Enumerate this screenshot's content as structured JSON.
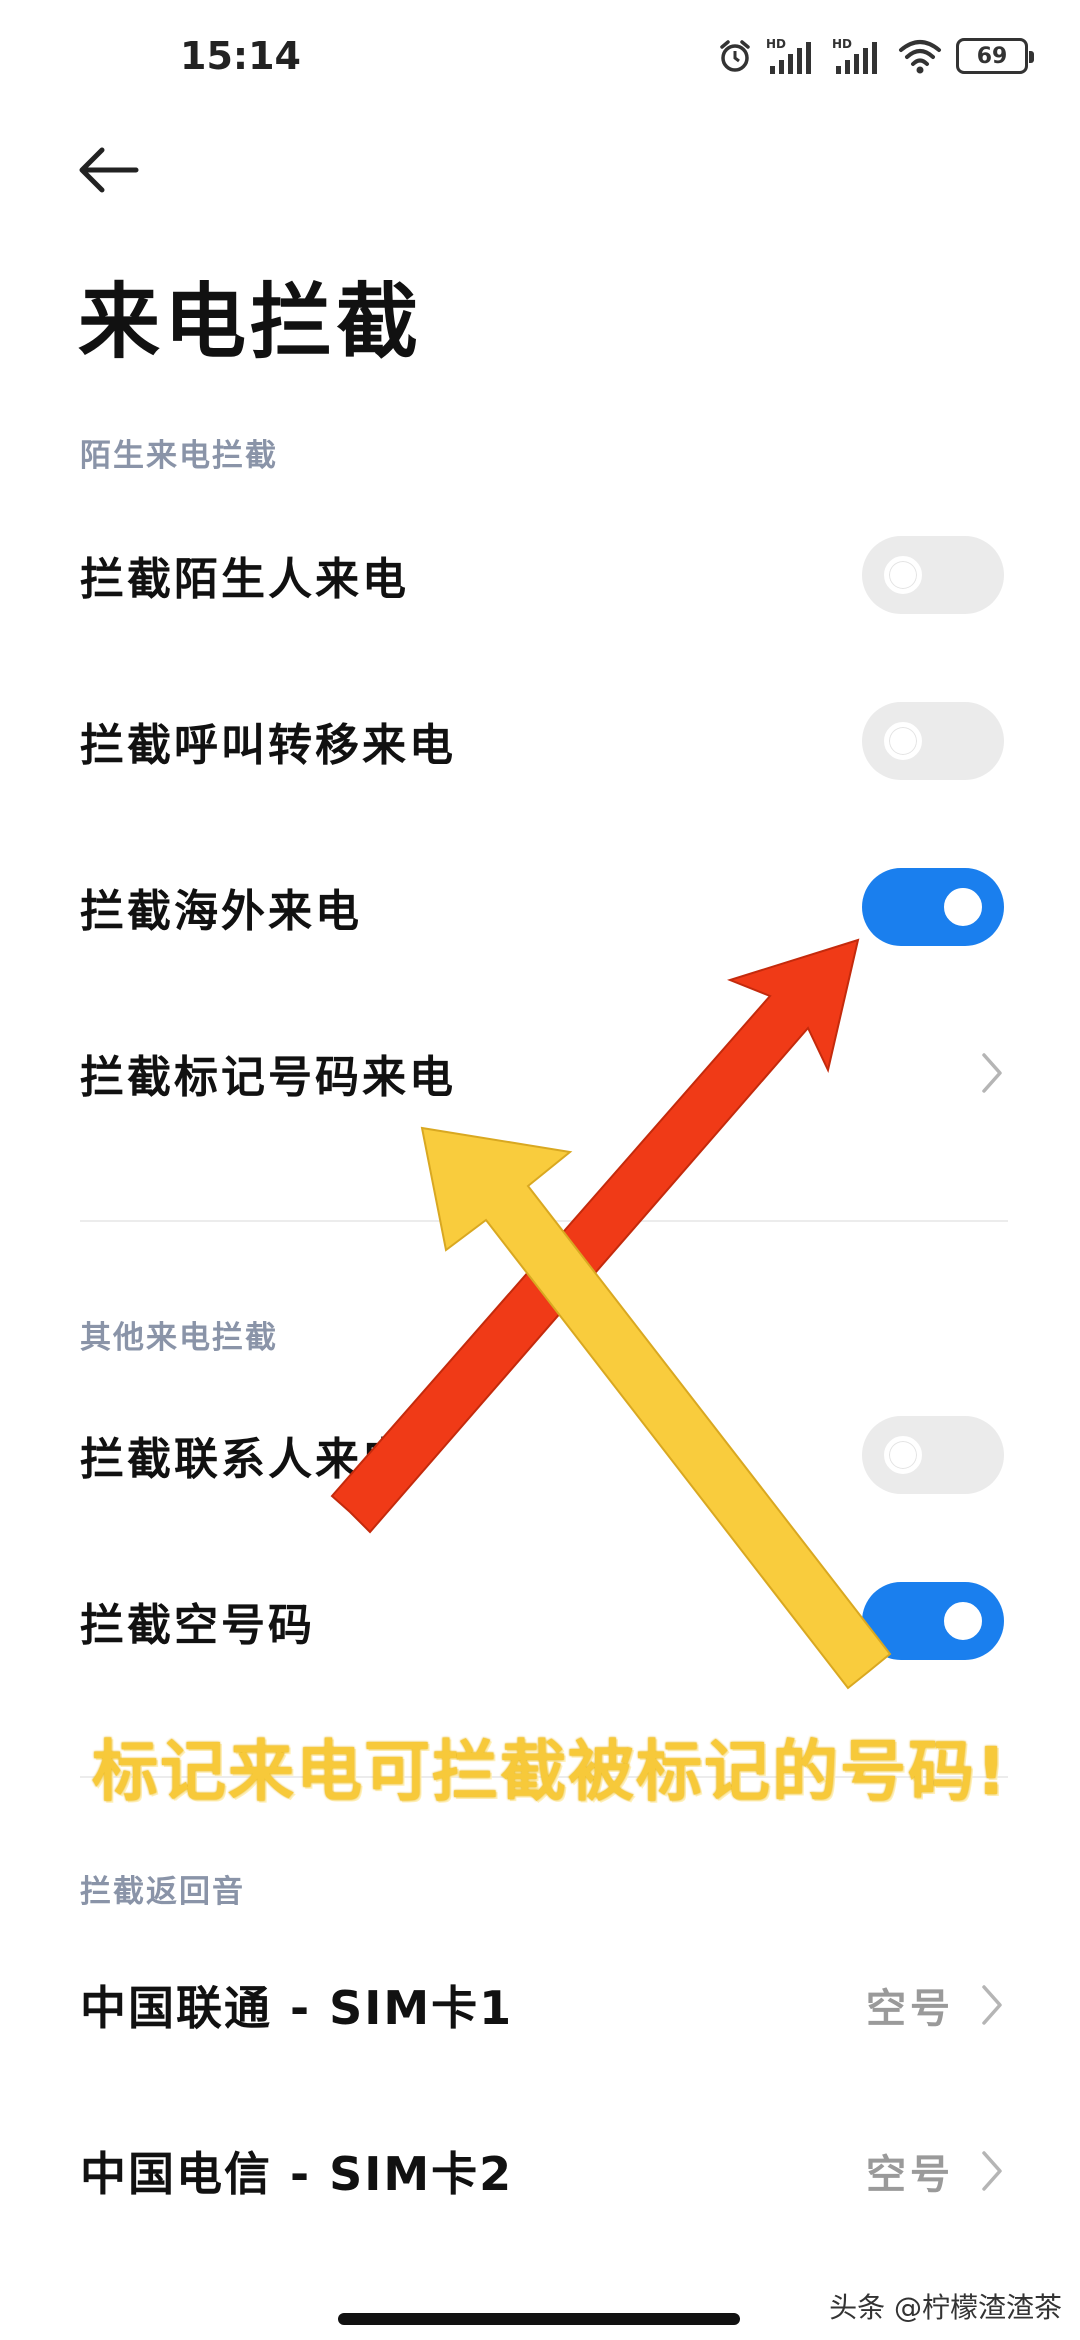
{
  "status_bar": {
    "time": "15:14",
    "battery": "69",
    "icons": [
      "alarm-icon",
      "hd-signal-icon",
      "hd-signal-icon",
      "wifi-icon",
      "battery-icon"
    ]
  },
  "header": {
    "back_icon": "back-arrow-icon",
    "title": "来电拦截"
  },
  "sections": {
    "stranger": {
      "header": "陌生来电拦截",
      "items": [
        {
          "label": "拦截陌生人来电",
          "toggle": false
        },
        {
          "label": "拦截呼叫转移来电",
          "toggle": false
        },
        {
          "label": "拦截海外来电",
          "toggle": true
        },
        {
          "label": "拦截标记号码来电",
          "chevron": true
        }
      ]
    },
    "other": {
      "header": "其他来电拦截",
      "items": [
        {
          "label": "拦截联系人来电",
          "toggle": false
        },
        {
          "label": "拦截空号码",
          "toggle": true
        }
      ]
    },
    "busy_tone": {
      "header": "拦截返回音",
      "items": [
        {
          "label": "中国联通 - SIM卡1",
          "value": "空号"
        },
        {
          "label": "中国电信 - SIM卡2",
          "value": "空号"
        }
      ]
    }
  },
  "annotation": {
    "text": "标记来电可拦截被标记的号码!",
    "arrow_colors": {
      "red": "#f03a17",
      "yellow": "#f9cc3d"
    }
  },
  "colors": {
    "toggle_on": "#1a7fee",
    "toggle_off": "#ebebeb",
    "section_header": "#8a94a8"
  },
  "watermark": "头条 @柠檬渣渣茶"
}
